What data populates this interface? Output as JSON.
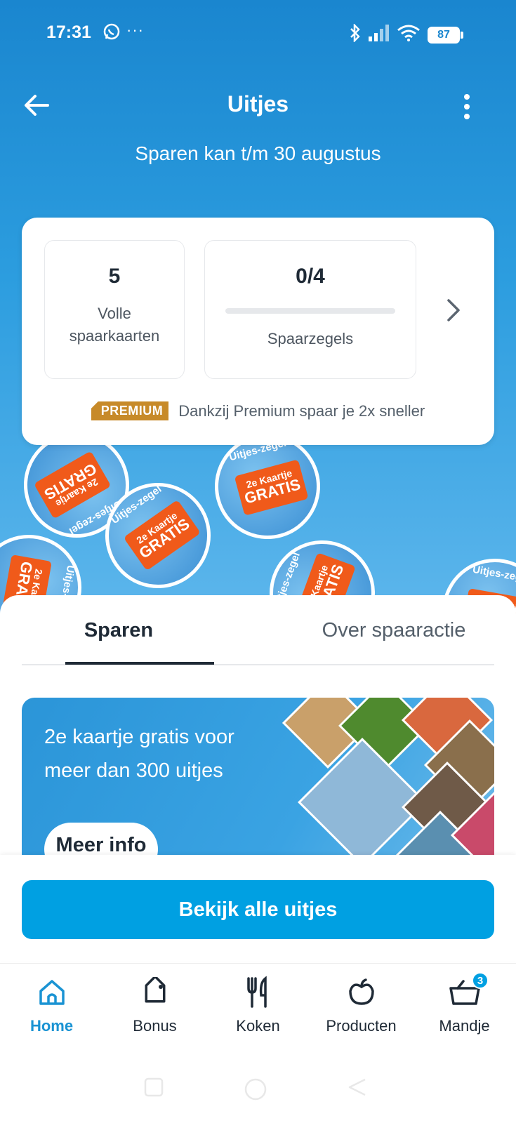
{
  "status": {
    "time": "17:31",
    "battery": "87",
    "icons": [
      "whatsapp-icon",
      "more-dots",
      "bluetooth-icon",
      "signal-icon",
      "wifi-icon",
      "battery-icon"
    ]
  },
  "header": {
    "title": "Uitjes",
    "subtitle": "Sparen kan t/m 30 augustus"
  },
  "savings": {
    "full_cards_value": "5",
    "full_cards_label": "Volle spaarkaarten",
    "stamps_value": "0/4",
    "stamps_progress": 0,
    "stamps_label": "Spaarzegels",
    "premium_badge": "PREMIUM",
    "premium_text": "Dankzij Premium spaar je 2x sneller"
  },
  "stamps": {
    "ring_text": "Uitjes-zegel",
    "ticket_line1": "2e Kaartje",
    "ticket_line2": "GRATIS"
  },
  "tabs": {
    "active": "Sparen",
    "inactive": "Over spaaractie"
  },
  "banner": {
    "text": "2e kaartje gratis voor meer dan 300 uitjes",
    "button": "Meer info"
  },
  "cta": {
    "label": "Bekijk alle uitjes"
  },
  "nav": {
    "items": [
      {
        "label": "Home",
        "icon": "home-icon",
        "active": true
      },
      {
        "label": "Bonus",
        "icon": "tag-icon",
        "active": false
      },
      {
        "label": "Koken",
        "icon": "cutlery-icon",
        "active": false
      },
      {
        "label": "Producten",
        "icon": "apple-icon",
        "active": false
      },
      {
        "label": "Mandje",
        "icon": "basket-icon",
        "active": false
      }
    ],
    "basket_count": "3"
  },
  "colors": {
    "primary": "#00a0e2",
    "hero_top": "#1a86cf",
    "premium": "#c78a29",
    "stamp_ticket": "#f05a1a",
    "text_dark": "#1f2a36"
  }
}
